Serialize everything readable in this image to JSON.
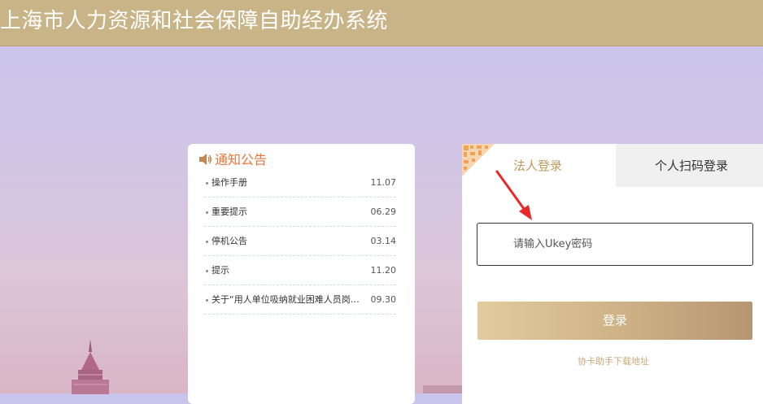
{
  "header": {
    "title": "上海市人力资源和社会保障自助经办系统"
  },
  "notice": {
    "title": "通知公告",
    "items": [
      {
        "text": "操作手册",
        "date": "11.07"
      },
      {
        "text": "重要提示",
        "date": "06.29"
      },
      {
        "text": "停机公告",
        "date": "03.14"
      },
      {
        "text": "提示",
        "date": "11.20"
      },
      {
        "text": "关于“用人单位吸纳就业困难人员岗位...",
        "date": "09.30"
      }
    ]
  },
  "login": {
    "tabs": {
      "legal": "法人登录",
      "personal": "个人扫码登录"
    },
    "ukey_placeholder": "请输入Ukey密码",
    "login_button": "登录",
    "download_link": "协卡助手下载地址"
  },
  "colors": {
    "header_bg": "#c9b487",
    "notice_title": "#e8763c",
    "tab_active": "#c19a5e",
    "button_start": "#e1cb9f",
    "button_end": "#b79573",
    "arrow": "#e8292b"
  },
  "icons": [
    "speaker-icon",
    "qr-corner-icon",
    "red-arrow-annotation"
  ]
}
